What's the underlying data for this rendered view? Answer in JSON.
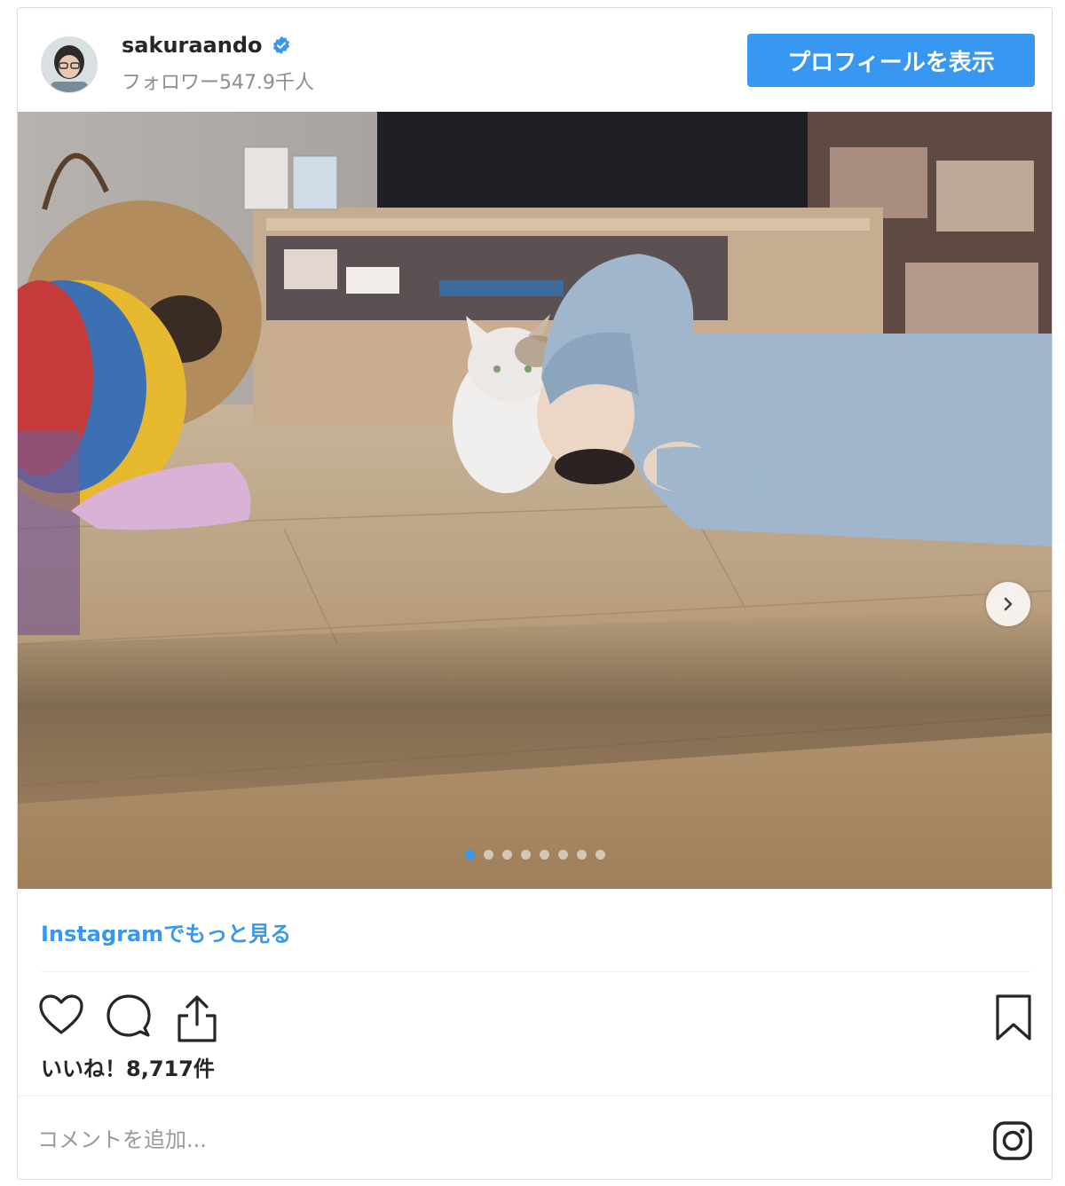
{
  "header": {
    "username": "sakuraando",
    "followers": "フォロワー547.9千人",
    "profile_button": "プロフィールを表示"
  },
  "photo": {
    "dot_count": 8,
    "active_index": 0
  },
  "links": {
    "more": "Instagramでもっと見る"
  },
  "stats": {
    "likes": "いいね！8,717件"
  },
  "comment": {
    "placeholder": "コメントを追加..."
  },
  "colors": {
    "accent": "#3897f0",
    "muted": "#8e8e8e",
    "text": "#262626"
  }
}
